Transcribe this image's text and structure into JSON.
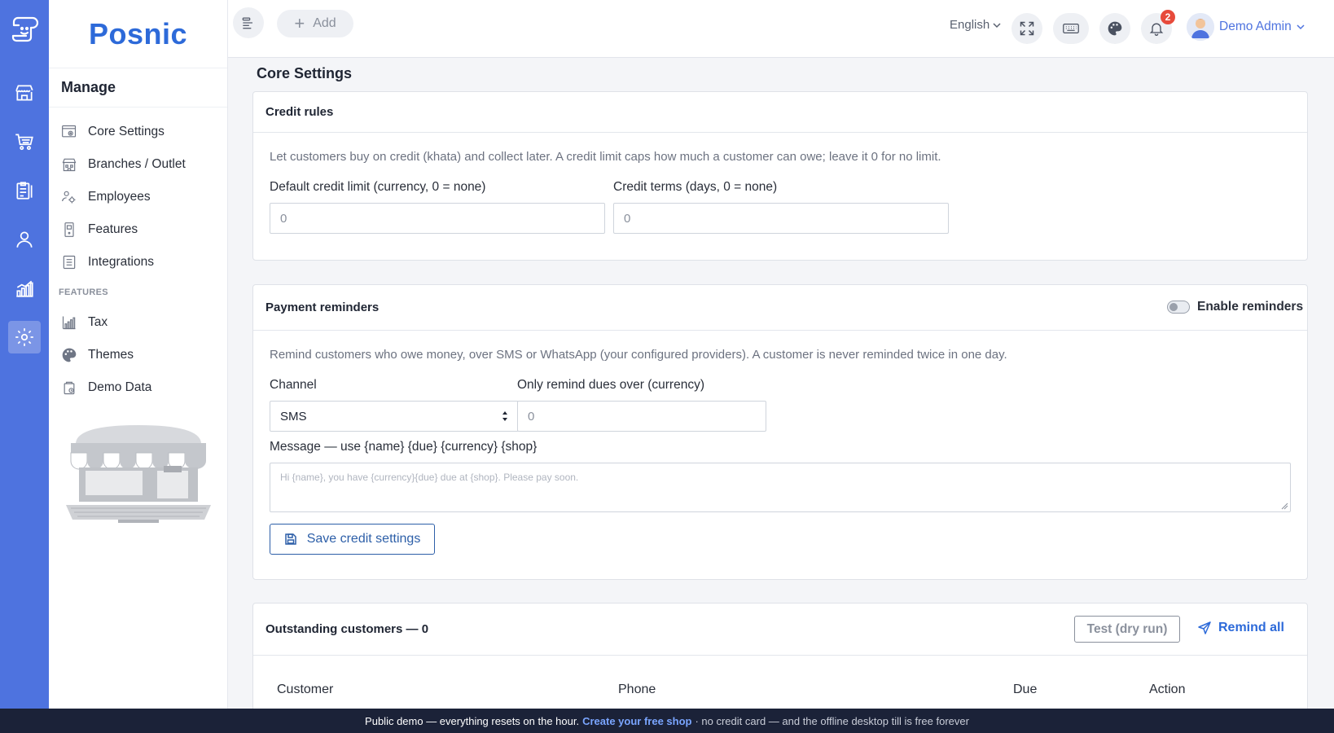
{
  "app": {
    "brand": "Posnic"
  },
  "rail": {
    "items": [
      {
        "icon": "store-icon"
      },
      {
        "icon": "cart-icon"
      },
      {
        "icon": "clipboard-icon"
      },
      {
        "icon": "user-icon"
      },
      {
        "icon": "chart-icon"
      },
      {
        "icon": "gear-icon",
        "active": true
      }
    ]
  },
  "sidebar": {
    "heading": "Manage",
    "items": [
      {
        "label": "Core Settings",
        "icon": "settings-window-icon"
      },
      {
        "label": "Branches / Outlet",
        "icon": "building-icon"
      },
      {
        "label": "Employees",
        "icon": "employees-gear-icon"
      },
      {
        "label": "Features",
        "icon": "device-icon"
      },
      {
        "label": "Integrations",
        "icon": "list-icon"
      }
    ],
    "section_label": "FEATURES",
    "feature_items": [
      {
        "label": "Tax",
        "icon": "tax-chart-icon"
      },
      {
        "label": "Themes",
        "icon": "palette-icon"
      },
      {
        "label": "Demo Data",
        "icon": "demo-data-icon"
      }
    ]
  },
  "topbar": {
    "add_label": "Add",
    "language": "English",
    "notification_count": "2",
    "user_name": "Demo Admin"
  },
  "page": {
    "title": "Core Settings",
    "credit_rules": {
      "title": "Credit rules",
      "help": "Let customers buy on credit (khata) and collect later. A credit limit caps how much a customer can owe; leave it 0 for no limit.",
      "default_limit_label": "Default credit limit (currency, 0 = none)",
      "default_limit_placeholder": "0",
      "terms_label": "Credit terms (days, 0 = none)",
      "terms_placeholder": "0"
    },
    "payment_reminders": {
      "title": "Payment reminders",
      "toggle_label": "Enable reminders",
      "enabled": false,
      "help": "Remind customers who owe money, over SMS or WhatsApp (your configured providers). A customer is never reminded twice in one day.",
      "channel_label": "Channel",
      "channel_value": "SMS",
      "min_due_label": "Only remind dues over (currency)",
      "min_due_placeholder": "0",
      "message_label": "Message — use {name} {due} {currency} {shop}",
      "message_placeholder": "Hi {name}, you have {currency}{due} due at {shop}. Please pay soon.",
      "save_label": "Save credit settings"
    },
    "outstanding": {
      "title": "Outstanding customers — 0",
      "test_label": "Test (dry run)",
      "remind_label": "Remind all",
      "columns": [
        "Customer",
        "Phone",
        "Due",
        "Action"
      ]
    }
  },
  "banner": {
    "text": "Public demo — everything resets on the hour.",
    "link": "Create your free shop",
    "rest": "· no credit card — and the offline desktop till is free forever"
  },
  "colors": {
    "rail": "#4e73df",
    "brand": "#2d6ad9",
    "banner": "#1b2238",
    "badge": "#e74a3b"
  }
}
